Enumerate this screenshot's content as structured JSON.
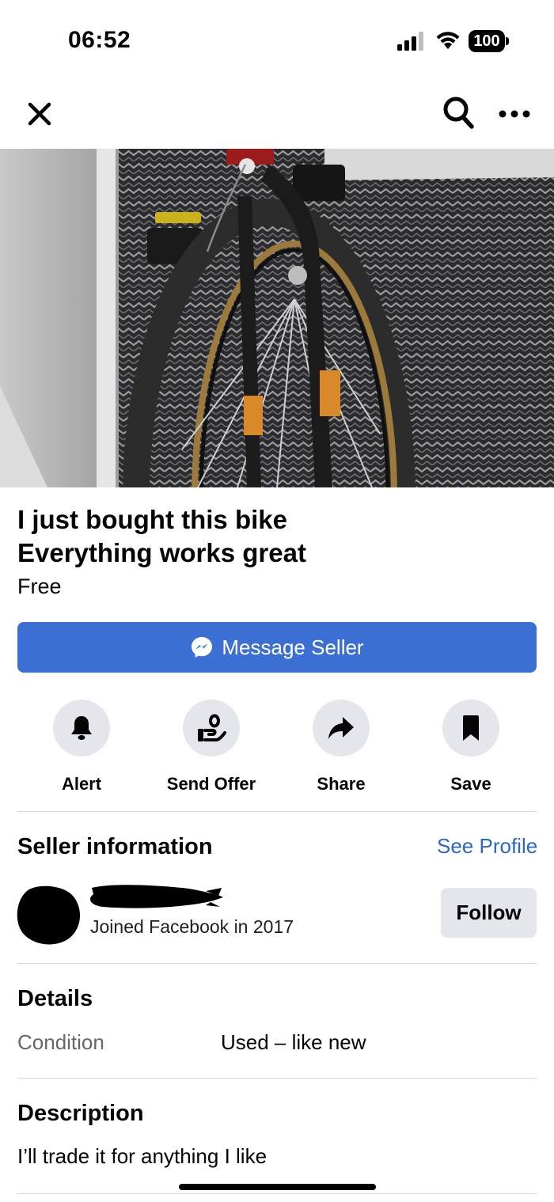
{
  "status_bar": {
    "time": "06:52",
    "battery": "100"
  },
  "nav": {
    "close_icon": "close-icon",
    "search_icon": "search-icon",
    "more_icon": "more-icon"
  },
  "listing": {
    "title_line1": "I just bought this bike",
    "title_line2": "Everything works great",
    "price": "Free"
  },
  "message_button": {
    "label": "Message Seller",
    "icon": "messenger-icon",
    "color": "#3b6fd4"
  },
  "actions": [
    {
      "label": "Alert",
      "icon": "bell-icon"
    },
    {
      "label": "Send Offer",
      "icon": "offer-icon"
    },
    {
      "label": "Share",
      "icon": "share-icon"
    },
    {
      "label": "Save",
      "icon": "bookmark-icon"
    }
  ],
  "seller": {
    "heading": "Seller information",
    "see_profile": "See Profile",
    "joined": "Joined Facebook in 2017",
    "follow_label": "Follow"
  },
  "details": {
    "heading": "Details",
    "condition_label": "Condition",
    "condition_value": "Used – like new"
  },
  "description": {
    "heading": "Description",
    "text": "I’ll trade it for anything I like"
  }
}
